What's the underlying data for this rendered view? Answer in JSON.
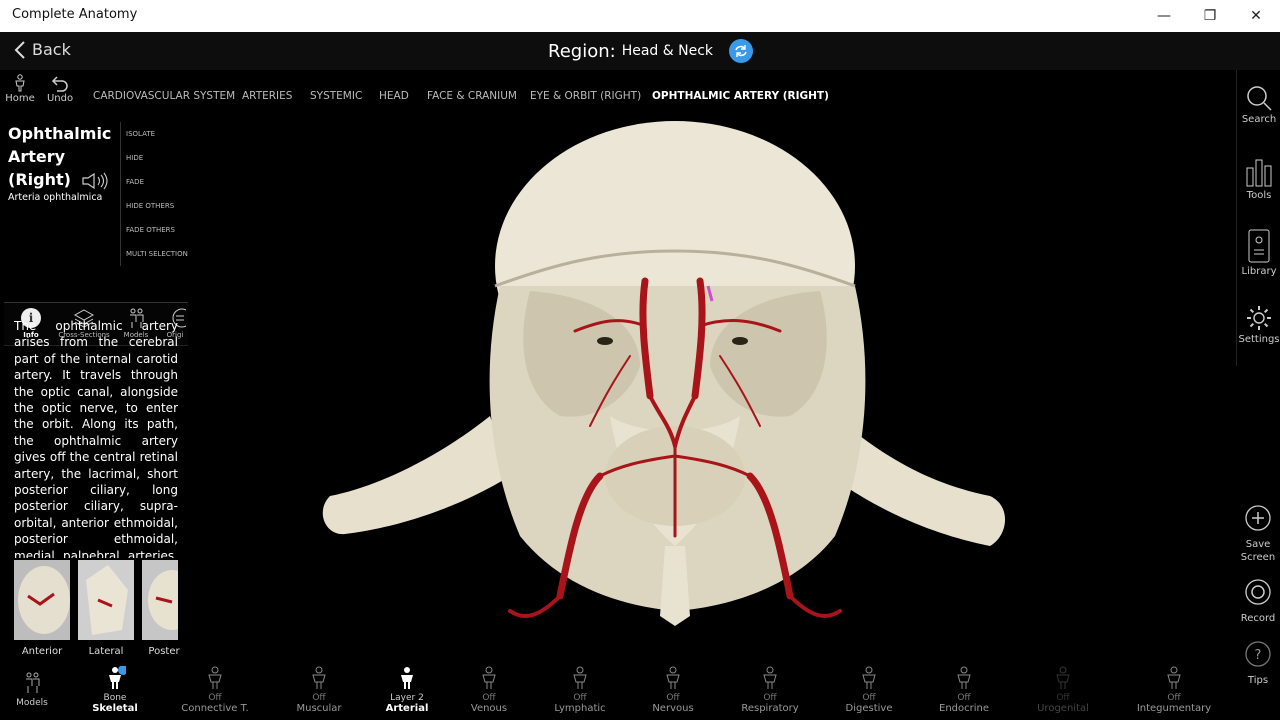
{
  "window": {
    "title": "Complete Anatomy"
  },
  "topbar": {
    "back_label": "Back",
    "region_label": "Region:",
    "region_value": "Head & Neck"
  },
  "toolbar": {
    "home_label": "Home",
    "undo_label": "Undo"
  },
  "breadcrumbs": [
    "CARDIOVASCULAR SYSTEM",
    "ARTERIES",
    "SYSTEMIC",
    "HEAD",
    "FACE & CRANIUM",
    "EYE & ORBIT (RIGHT)",
    "OPHTHALMIC ARTERY (RIGHT)"
  ],
  "structure": {
    "title": "Ophthalmic Artery (Right)",
    "latin": "Arteria ophthalmica",
    "actions": [
      "ISOLATE",
      "HIDE",
      "FADE",
      "HIDE OTHERS",
      "FADE OTHERS",
      "MULTI SELECTION"
    ]
  },
  "subtabs": [
    "Info",
    "Cross-Sections",
    "Models",
    "Origi"
  ],
  "info": {
    "text": "The ophthalmic artery arises from the cerebral part of the internal carotid artery. It travels through the optic canal, alongside the optic nerve, to enter the orbit. Along its path, the ophthalmic artery gives off the central retinal artery, the lacrimal, short posterior ciliary, long posterior ciliary, supra-orbital, anterior ethmoidal, posterior ethmoidal, medial palpebral arteries, as well as muscular and recurrent"
  },
  "views": [
    "Anterior",
    "Lateral",
    "Poster"
  ],
  "right_tools": [
    "Search",
    "Tools",
    "Library",
    "Settings"
  ],
  "right_actions": {
    "save": "Save Screen",
    "record": "Record",
    "tips": "Tips"
  },
  "bottom": {
    "models_label": "Models",
    "systems": [
      {
        "state": "Bone",
        "name": "Skeletal"
      },
      {
        "state": "Off",
        "name": "Connective T."
      },
      {
        "state": "Off",
        "name": "Muscular"
      },
      {
        "state": "Layer 2",
        "name": "Arterial"
      },
      {
        "state": "Off",
        "name": "Venous"
      },
      {
        "state": "Off",
        "name": "Lymphatic"
      },
      {
        "state": "Off",
        "name": "Nervous"
      },
      {
        "state": "Off",
        "name": "Respiratory"
      },
      {
        "state": "Off",
        "name": "Digestive"
      },
      {
        "state": "Off",
        "name": "Endocrine"
      },
      {
        "state": "Off",
        "name": "Urogenital"
      },
      {
        "state": "Off",
        "name": "Integumentary"
      }
    ]
  },
  "colors": {
    "accent": "#3a9ae8",
    "bone": "#e8e2d0",
    "artery": "#a8141a"
  }
}
